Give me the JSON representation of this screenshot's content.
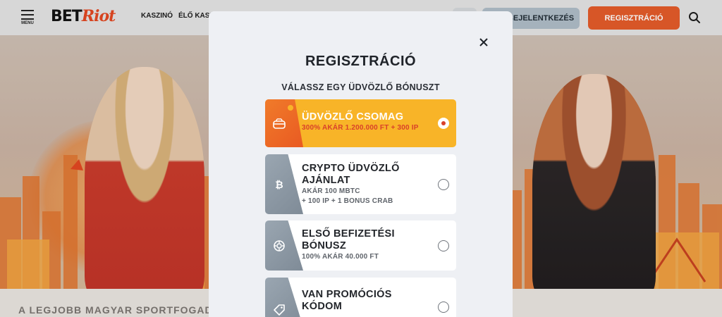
{
  "header": {
    "menu_label": "MENU",
    "logo_bet": "BET",
    "logo_riot": "Riot",
    "nav": [
      "KASZINÓ",
      "ÉLŐ KASZ"
    ],
    "login_label": "BEJELENTKEZÉS",
    "register_label": "REGISZTRÁCIÓ"
  },
  "hero": {
    "bottom_text": "A LEGJOBB MAGYAR SPORTFOGADÁS"
  },
  "modal": {
    "title": "REGISZTRÁCIÓ",
    "subtitle": "VÁLASSZ EGY ÜDVÖZLŐ BÓNUSZT",
    "bonuses": [
      {
        "title": "ÜDVÖZLŐ CSOMAG",
        "desc": "300% AKÁR 1.200.000 FT + 300 IP",
        "selected": true,
        "icon": "gift-icon"
      },
      {
        "title_line1": "CRYPTO ÜDVÖZLŐ",
        "title_line2": "AJÁNLAT",
        "desc_line1": "AKÁR 100 MBTC",
        "desc_line2": "+ 100 IP + 1 BONUS CRAB",
        "selected": false,
        "icon": "bitcoin-icon"
      },
      {
        "title_line1": "ELSŐ BEFIZETÉSI",
        "title_line2": "BÓNUSZ",
        "desc": "100% AKÁR 40.000 FT",
        "selected": false,
        "icon": "chip-icon"
      },
      {
        "title_line1": "VAN PROMÓCIÓS",
        "title_line2": "KÓDOM",
        "selected": false,
        "icon": "tag-icon"
      }
    ]
  },
  "colors": {
    "accent_orange": "#e35a28",
    "selected_card": "#f8b428",
    "selected_desc": "#d9412a",
    "card_side_gray": "#8e9aa6"
  }
}
